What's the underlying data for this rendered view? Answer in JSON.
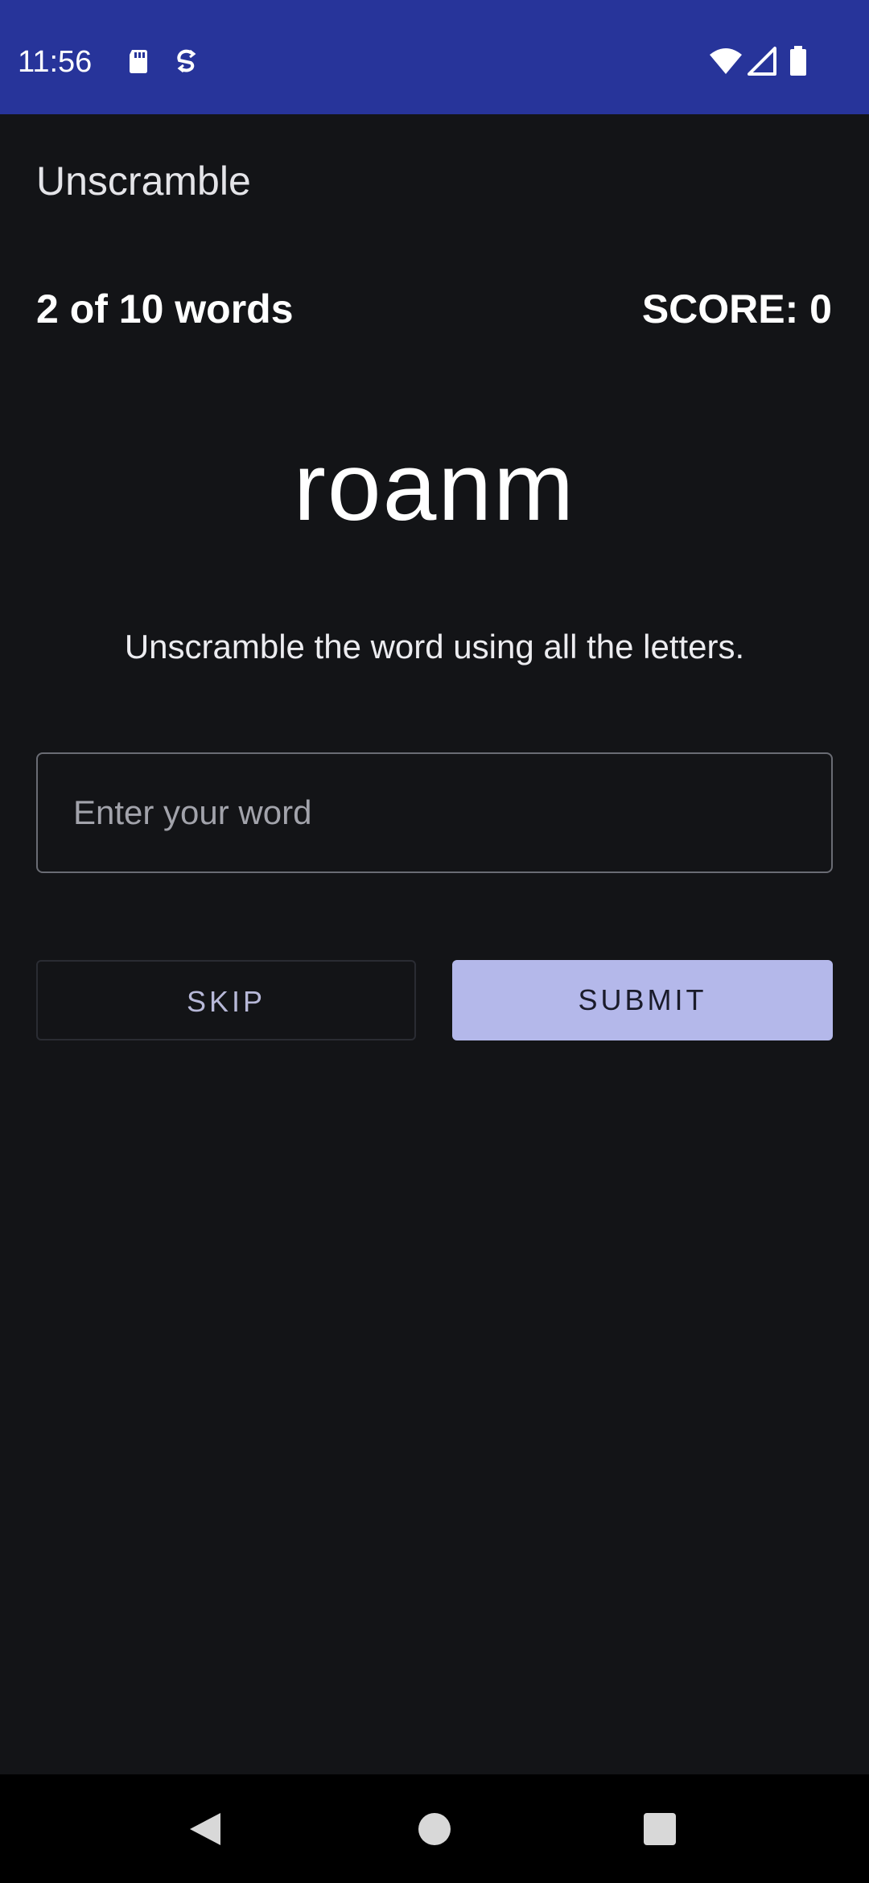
{
  "status_bar": {
    "time": "11:56",
    "icons": [
      "sd-card-icon",
      "sync-icon",
      "wifi-icon",
      "cell-signal-icon",
      "battery-icon"
    ],
    "background_color": "#27349a"
  },
  "app_bar": {
    "title": "Unscramble"
  },
  "game": {
    "word_count": "2 of 10 words",
    "score": "SCORE: 0",
    "scrambled_word": "roanm",
    "instructions": "Unscramble the word using all the letters."
  },
  "input": {
    "placeholder": "Enter your word",
    "value": ""
  },
  "buttons": {
    "skip_label": "SKIP",
    "submit_label": "SUBMIT",
    "submit_color": "#b4b8ea"
  },
  "navigation_bar": {
    "icons": [
      "back-icon",
      "home-icon",
      "recents-icon"
    ]
  }
}
